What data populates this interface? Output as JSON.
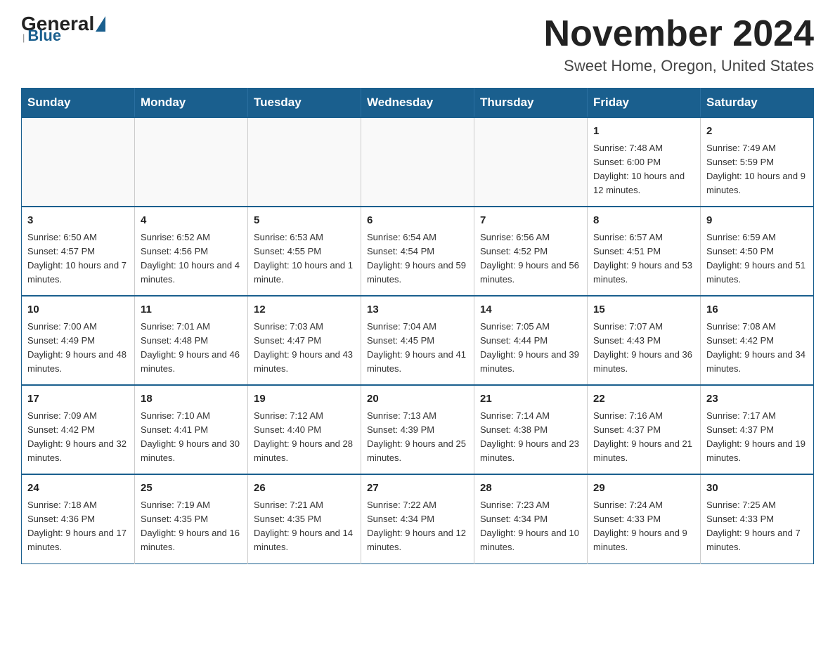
{
  "header": {
    "logo_general": "General",
    "logo_blue": "Blue",
    "month_title": "November 2024",
    "location": "Sweet Home, Oregon, United States"
  },
  "days_of_week": [
    "Sunday",
    "Monday",
    "Tuesday",
    "Wednesday",
    "Thursday",
    "Friday",
    "Saturday"
  ],
  "weeks": [
    [
      {
        "day": "",
        "info": ""
      },
      {
        "day": "",
        "info": ""
      },
      {
        "day": "",
        "info": ""
      },
      {
        "day": "",
        "info": ""
      },
      {
        "day": "",
        "info": ""
      },
      {
        "day": "1",
        "info": "Sunrise: 7:48 AM\nSunset: 6:00 PM\nDaylight: 10 hours and 12 minutes."
      },
      {
        "day": "2",
        "info": "Sunrise: 7:49 AM\nSunset: 5:59 PM\nDaylight: 10 hours and 9 minutes."
      }
    ],
    [
      {
        "day": "3",
        "info": "Sunrise: 6:50 AM\nSunset: 4:57 PM\nDaylight: 10 hours and 7 minutes."
      },
      {
        "day": "4",
        "info": "Sunrise: 6:52 AM\nSunset: 4:56 PM\nDaylight: 10 hours and 4 minutes."
      },
      {
        "day": "5",
        "info": "Sunrise: 6:53 AM\nSunset: 4:55 PM\nDaylight: 10 hours and 1 minute."
      },
      {
        "day": "6",
        "info": "Sunrise: 6:54 AM\nSunset: 4:54 PM\nDaylight: 9 hours and 59 minutes."
      },
      {
        "day": "7",
        "info": "Sunrise: 6:56 AM\nSunset: 4:52 PM\nDaylight: 9 hours and 56 minutes."
      },
      {
        "day": "8",
        "info": "Sunrise: 6:57 AM\nSunset: 4:51 PM\nDaylight: 9 hours and 53 minutes."
      },
      {
        "day": "9",
        "info": "Sunrise: 6:59 AM\nSunset: 4:50 PM\nDaylight: 9 hours and 51 minutes."
      }
    ],
    [
      {
        "day": "10",
        "info": "Sunrise: 7:00 AM\nSunset: 4:49 PM\nDaylight: 9 hours and 48 minutes."
      },
      {
        "day": "11",
        "info": "Sunrise: 7:01 AM\nSunset: 4:48 PM\nDaylight: 9 hours and 46 minutes."
      },
      {
        "day": "12",
        "info": "Sunrise: 7:03 AM\nSunset: 4:47 PM\nDaylight: 9 hours and 43 minutes."
      },
      {
        "day": "13",
        "info": "Sunrise: 7:04 AM\nSunset: 4:45 PM\nDaylight: 9 hours and 41 minutes."
      },
      {
        "day": "14",
        "info": "Sunrise: 7:05 AM\nSunset: 4:44 PM\nDaylight: 9 hours and 39 minutes."
      },
      {
        "day": "15",
        "info": "Sunrise: 7:07 AM\nSunset: 4:43 PM\nDaylight: 9 hours and 36 minutes."
      },
      {
        "day": "16",
        "info": "Sunrise: 7:08 AM\nSunset: 4:42 PM\nDaylight: 9 hours and 34 minutes."
      }
    ],
    [
      {
        "day": "17",
        "info": "Sunrise: 7:09 AM\nSunset: 4:42 PM\nDaylight: 9 hours and 32 minutes."
      },
      {
        "day": "18",
        "info": "Sunrise: 7:10 AM\nSunset: 4:41 PM\nDaylight: 9 hours and 30 minutes."
      },
      {
        "day": "19",
        "info": "Sunrise: 7:12 AM\nSunset: 4:40 PM\nDaylight: 9 hours and 28 minutes."
      },
      {
        "day": "20",
        "info": "Sunrise: 7:13 AM\nSunset: 4:39 PM\nDaylight: 9 hours and 25 minutes."
      },
      {
        "day": "21",
        "info": "Sunrise: 7:14 AM\nSunset: 4:38 PM\nDaylight: 9 hours and 23 minutes."
      },
      {
        "day": "22",
        "info": "Sunrise: 7:16 AM\nSunset: 4:37 PM\nDaylight: 9 hours and 21 minutes."
      },
      {
        "day": "23",
        "info": "Sunrise: 7:17 AM\nSunset: 4:37 PM\nDaylight: 9 hours and 19 minutes."
      }
    ],
    [
      {
        "day": "24",
        "info": "Sunrise: 7:18 AM\nSunset: 4:36 PM\nDaylight: 9 hours and 17 minutes."
      },
      {
        "day": "25",
        "info": "Sunrise: 7:19 AM\nSunset: 4:35 PM\nDaylight: 9 hours and 16 minutes."
      },
      {
        "day": "26",
        "info": "Sunrise: 7:21 AM\nSunset: 4:35 PM\nDaylight: 9 hours and 14 minutes."
      },
      {
        "day": "27",
        "info": "Sunrise: 7:22 AM\nSunset: 4:34 PM\nDaylight: 9 hours and 12 minutes."
      },
      {
        "day": "28",
        "info": "Sunrise: 7:23 AM\nSunset: 4:34 PM\nDaylight: 9 hours and 10 minutes."
      },
      {
        "day": "29",
        "info": "Sunrise: 7:24 AM\nSunset: 4:33 PM\nDaylight: 9 hours and 9 minutes."
      },
      {
        "day": "30",
        "info": "Sunrise: 7:25 AM\nSunset: 4:33 PM\nDaylight: 9 hours and 7 minutes."
      }
    ]
  ]
}
